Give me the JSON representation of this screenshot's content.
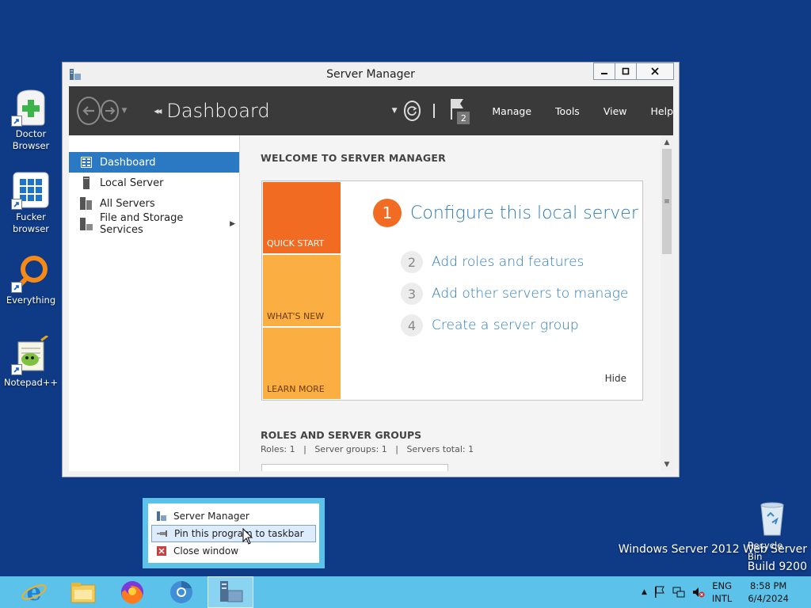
{
  "desktop": {
    "icons": [
      {
        "label": "Doctor Browser",
        "icon": "doctor-browser-icon"
      },
      {
        "label": "Fucker browser",
        "icon": "fucker-browser-icon"
      },
      {
        "label": "Everything",
        "icon": "everything-search-icon"
      },
      {
        "label": "Notepad++",
        "icon": "notepad-plus-plus-icon"
      }
    ],
    "recycle_bin": {
      "label": "Recycle Bin",
      "icon": "recycle-bin-icon"
    },
    "watermark": {
      "line1": "Windows Server 2012 Web Server",
      "line2": "Build 9200"
    }
  },
  "window": {
    "title": "Server Manager",
    "controls": {
      "minimize": "—",
      "maximize": "□",
      "close": "✕"
    }
  },
  "toolbar": {
    "breadcrumb_arrows": "◂◂",
    "breadcrumb": "Dashboard",
    "notification_count": "2",
    "menus": {
      "manage": "Manage",
      "tools": "Tools",
      "view": "View",
      "help": "Help"
    }
  },
  "nav": {
    "items": [
      {
        "label": "Dashboard",
        "active": true
      },
      {
        "label": "Local Server",
        "active": false
      },
      {
        "label": "All Servers",
        "active": false
      },
      {
        "label": "File and Storage Services",
        "active": false
      }
    ]
  },
  "welcome": {
    "heading": "WELCOME TO SERVER MANAGER",
    "tiles": {
      "quick_start": "QUICK START",
      "whats_new": "WHAT'S NEW",
      "learn_more": "LEARN MORE"
    },
    "steps": [
      {
        "num": "1",
        "label": "Configure this local server"
      },
      {
        "num": "2",
        "label": "Add roles and features"
      },
      {
        "num": "3",
        "label": "Add other servers to manage"
      },
      {
        "num": "4",
        "label": "Create a server group"
      }
    ],
    "hide": "Hide"
  },
  "roles": {
    "heading": "ROLES AND SERVER GROUPS",
    "summary": "Roles: 1   |   Server groups: 1   |   Servers total: 1"
  },
  "jumplist": {
    "items": [
      {
        "label": "Server Manager",
        "icon": "server-manager-icon"
      },
      {
        "label": "Pin this program to taskbar",
        "icon": "pin-icon",
        "highlighted": true
      },
      {
        "label": "Close window",
        "icon": "close-window-icon"
      }
    ]
  },
  "taskbar": {
    "apps": [
      "internet-explorer-icon",
      "file-explorer-icon",
      "firefox-icon",
      "chromium-icon",
      "server-manager-icon"
    ],
    "lang": {
      "line1": "ENG",
      "line2": "INTL"
    },
    "clock": {
      "time": "8:58 PM",
      "date": "6/4/2024"
    }
  },
  "colors": {
    "desktop": "#0f3a86",
    "accent_blue": "#2b79c2",
    "quick_start_orange": "#f26b22",
    "tile_yellow": "#fbae41",
    "taskbar": "#5cc2ea",
    "link_blue": "#2a7ab8"
  }
}
